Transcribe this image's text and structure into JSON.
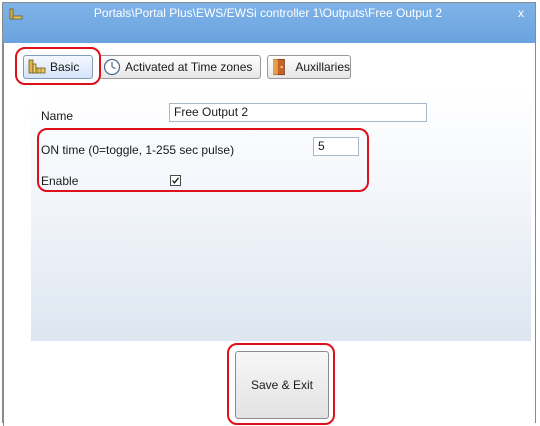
{
  "window": {
    "title": "Portals\\Portal Plus\\EWS/EWSi controller 1\\Outputs\\Free Output 2",
    "close_glyph": "x"
  },
  "tabs": [
    {
      "label": "Basic",
      "icon": "tile-icon",
      "active": true
    },
    {
      "label": "Activated at Time zones",
      "icon": "clock-icon",
      "active": false
    },
    {
      "label": "Auxillaries",
      "icon": "door-icon",
      "active": false
    }
  ],
  "form": {
    "name_label": "Name",
    "name_value": "Free Output 2",
    "on_time_label": "ON time (0=toggle, 1-255 sec pulse)",
    "on_time_value": "5",
    "enable_label": "Enable",
    "enable_checked": true
  },
  "footer": {
    "save_label": "Save & Exit"
  },
  "colors": {
    "titlebar": "#7fb3e8",
    "highlight": "#e0101a"
  }
}
